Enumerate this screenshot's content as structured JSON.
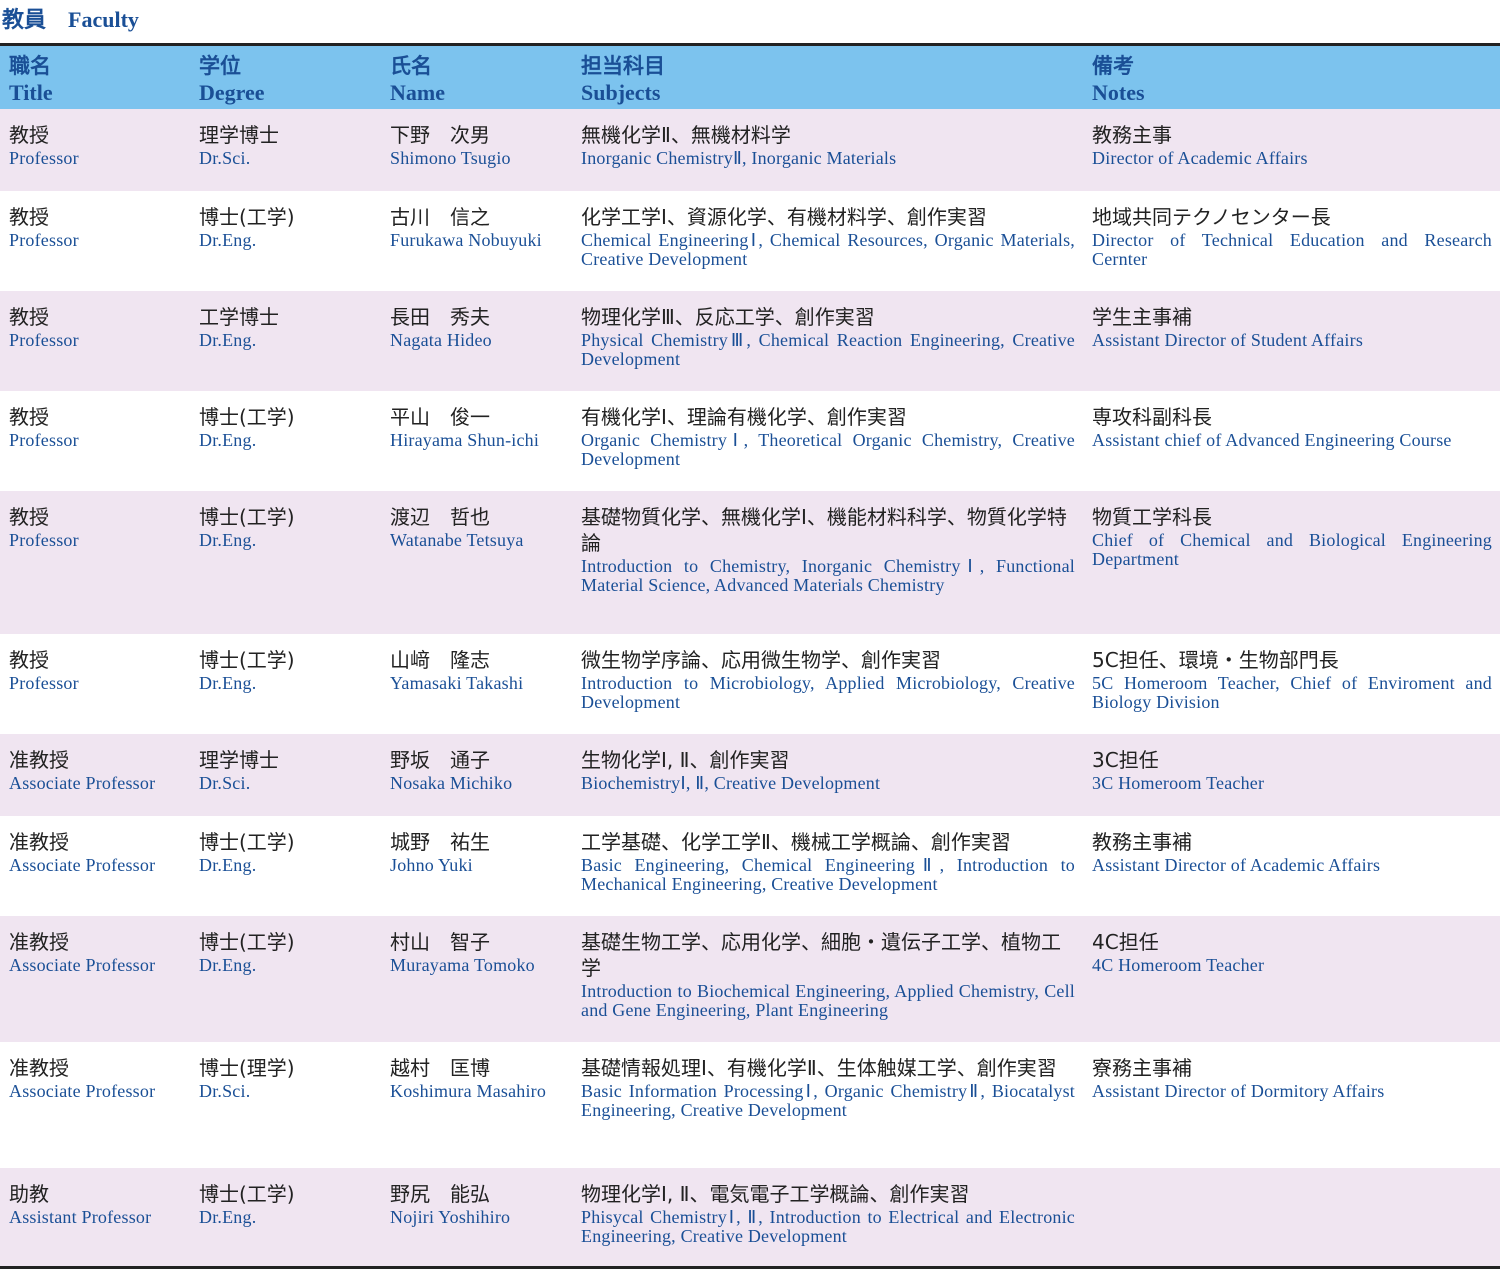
{
  "heading": {
    "jp": "教員",
    "en": "Faculty"
  },
  "columns": [
    {
      "jp": "職名",
      "en": "Title"
    },
    {
      "jp": "学位",
      "en": "Degree"
    },
    {
      "jp": "氏名",
      "en": "Name"
    },
    {
      "jp": "担当科目",
      "en": "Subjects"
    },
    {
      "jp": "備考",
      "en": "Notes"
    }
  ],
  "rows": [
    {
      "title_jp": "教授",
      "title_en": "Professor",
      "degree_jp": "理学博士",
      "degree_en": "Dr.Sci.",
      "name_jp": "下野　次男",
      "name_en": "Shimono Tsugio",
      "subjects_jp": "無機化学Ⅱ、無機材料学",
      "subjects_en": "Inorganic ChemistryⅡ, Inorganic Materials",
      "notes_jp": "教務主事",
      "notes_en": "Director of Academic Affairs"
    },
    {
      "title_jp": "教授",
      "title_en": "Professor",
      "degree_jp": "博士(工学)",
      "degree_en": "Dr.Eng.",
      "name_jp": "古川　信之",
      "name_en": "Furukawa Nobuyuki",
      "subjects_jp": "化学工学Ⅰ、資源化学、有機材料学、創作実習",
      "subjects_en": "Chemical EngineeringⅠ, Chemical Resources, Organic Materials, Creative Development",
      "notes_jp": "地域共同テクノセンター長",
      "notes_en": "Director of Technical Education and Research Cernter"
    },
    {
      "title_jp": "教授",
      "title_en": "Professor",
      "degree_jp": "工学博士",
      "degree_en": "Dr.Eng.",
      "name_jp": "長田　秀夫",
      "name_en": "Nagata Hideo",
      "subjects_jp": "物理化学Ⅲ、反応工学、創作実習",
      "subjects_en": "Physical ChemistryⅢ, Chemical Reaction Engineering, Creative Development",
      "notes_jp": "学生主事補",
      "notes_en": "Assistant Director of Student Affairs"
    },
    {
      "title_jp": "教授",
      "title_en": "Professor",
      "degree_jp": "博士(工学)",
      "degree_en": "Dr.Eng.",
      "name_jp": "平山　俊一",
      "name_en": "Hirayama Shun-ichi",
      "subjects_jp": "有機化学Ⅰ、理論有機化学、創作実習",
      "subjects_en": "Organic ChemistryⅠ, Theoretical Organic Chemistry, Creative Development",
      "notes_jp": "専攻科副科長",
      "notes_en": "Assistant chief of Advanced Engineering Course"
    },
    {
      "title_jp": "教授",
      "title_en": "Professor",
      "degree_jp": "博士(工学)",
      "degree_en": "Dr.Eng.",
      "name_jp": "渡辺　哲也",
      "name_en": "Watanabe Tetsuya",
      "subjects_jp": "基礎物質化学、無機化学Ⅰ、機能材料科学、物質化学特論",
      "subjects_en": "Introduction to Chemistry, Inorganic ChemistryⅠ, Functional Material Science, Advanced Materials Chemistry",
      "notes_jp": "物質工学科長",
      "notes_en": "Chief of Chemical and Biological Engineering Department"
    },
    {
      "title_jp": "教授",
      "title_en": "Professor",
      "degree_jp": "博士(工学)",
      "degree_en": "Dr.Eng.",
      "name_jp": "山﨑　隆志",
      "name_en": "Yamasaki Takashi",
      "subjects_jp": "微生物学序論、応用微生物学、創作実習",
      "subjects_en": "Introduction to Microbiology, Applied Microbiology, Creative Development",
      "notes_jp": "5C担任、環境・生物部門長",
      "notes_en": "5C Homeroom Teacher, Chief of Enviroment and Biology Division"
    },
    {
      "title_jp": "准教授",
      "title_en": "Associate Professor",
      "degree_jp": "理学博士",
      "degree_en": "Dr.Sci.",
      "name_jp": "野坂　通子",
      "name_en": "Nosaka Michiko",
      "subjects_jp": "生物化学Ⅰ, Ⅱ、創作実習",
      "subjects_en": "BiochemistryⅠ, Ⅱ, Creative Development",
      "notes_jp": "3C担任",
      "notes_en": "3C Homeroom Teacher"
    },
    {
      "title_jp": "准教授",
      "title_en": "Associate Professor",
      "degree_jp": "博士(工学)",
      "degree_en": "Dr.Eng.",
      "name_jp": "城野　祐生",
      "name_en": "Johno Yuki",
      "subjects_jp": "工学基礎、化学工学Ⅱ、機械工学概論、創作実習",
      "subjects_en": "Basic Engineering, Chemical EngineeringⅡ, Introduction to Mechanical Engineering, Creative Development",
      "notes_jp": "教務主事補",
      "notes_en": "Assistant Director of Academic Affairs"
    },
    {
      "title_jp": "准教授",
      "title_en": "Associate Professor",
      "degree_jp": "博士(工学)",
      "degree_en": "Dr.Eng.",
      "name_jp": "村山　智子",
      "name_en": "Murayama Tomoko",
      "subjects_jp": "基礎生物工学、応用化学、細胞・遺伝子工学、植物工学",
      "subjects_en": "Introduction to Biochemical Engineering, Applied Chemistry, Cell and Gene Engineering, Plant Engineering",
      "notes_jp": "4C担任",
      "notes_en": "4C Homeroom Teacher"
    },
    {
      "title_jp": "准教授",
      "title_en": "Associate Professor",
      "degree_jp": "博士(理学)",
      "degree_en": "Dr.Sci.",
      "name_jp": "越村　匡博",
      "name_en": "Koshimura Masahiro",
      "subjects_jp": "基礎情報処理Ⅰ、有機化学Ⅱ、生体触媒工学、創作実習",
      "subjects_en": "Basic Information ProcessingⅠ, Organic ChemistryⅡ, Biocatalyst Engineering, Creative Development",
      "notes_jp": "寮務主事補",
      "notes_en": "Assistant Director of Dormitory Affairs"
    },
    {
      "title_jp": "助教",
      "title_en": "Assistant Professor",
      "degree_jp": "博士(工学)",
      "degree_en": "Dr.Eng.",
      "name_jp": "野尻　能弘",
      "name_en": "Nojiri Yoshihiro",
      "subjects_jp": "物理化学Ⅰ, Ⅱ、電気電子工学概論、創作実習",
      "subjects_en": "Phisycal ChemistryⅠ, Ⅱ, Introduction to Electrical and Electronic Engineering, Creative Development",
      "notes_jp": "",
      "notes_en": ""
    }
  ]
}
